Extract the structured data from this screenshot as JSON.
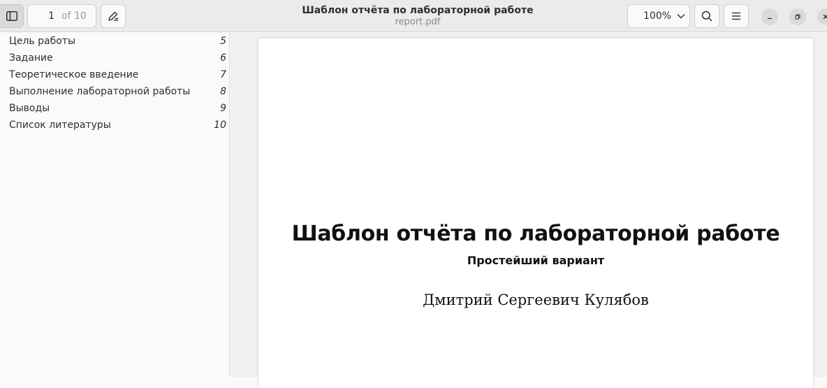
{
  "header": {
    "page_current": "1",
    "page_total": "of 10",
    "title": "Шаблон отчёта по лабораторной работе",
    "filename": "report.pdf",
    "zoom": "100%"
  },
  "icons": {
    "sidebar_toggle": "sidebar-icon",
    "annotate": "pen-annotate-icon",
    "zoom_dropdown": "chevron-down-icon",
    "search": "search-icon",
    "menu": "hamburger-menu-icon",
    "minimize": "minimize-icon",
    "maximize": "restore-icon",
    "close": "close-icon"
  },
  "sidebar": {
    "items": [
      {
        "label": "Цель работы",
        "page": "5"
      },
      {
        "label": "Задание",
        "page": "6"
      },
      {
        "label": "Теоретическое введение",
        "page": "7"
      },
      {
        "label": "Выполнение лабораторной работы",
        "page": "8"
      },
      {
        "label": "Выводы",
        "page": "9"
      },
      {
        "label": "Список литературы",
        "page": "10"
      }
    ]
  },
  "document": {
    "title": "Шаблон отчёта по лабораторной работе",
    "subtitle": "Простейший вариант",
    "author": "Дмитрий Сергеевич Кулябов"
  }
}
